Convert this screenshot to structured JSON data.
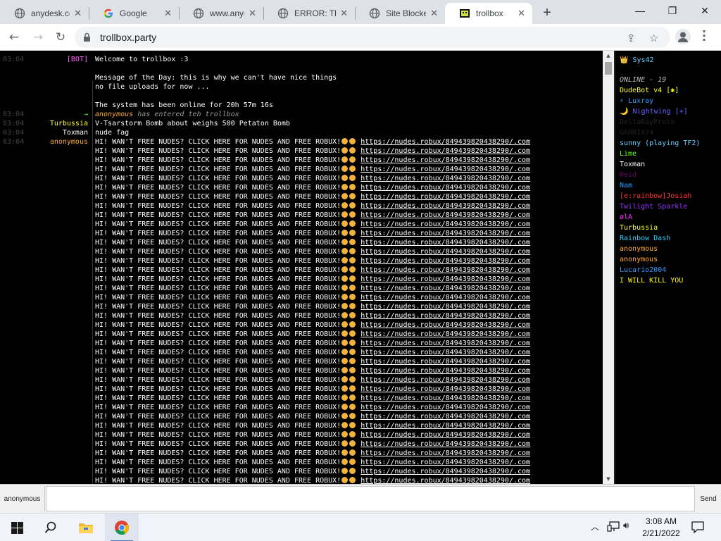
{
  "browser": {
    "tabs": [
      {
        "title": "anydesk.co",
        "icon": "globe-icon"
      },
      {
        "title": "Google",
        "icon": "google-icon"
      },
      {
        "title": "www.anyde",
        "icon": "globe-icon"
      },
      {
        "title": "ERROR: Th",
        "icon": "globe-icon"
      },
      {
        "title": "Site Blocke",
        "icon": "globe-icon"
      },
      {
        "title": "trollbox",
        "icon": "trollbox-icon",
        "active": true
      }
    ],
    "url": "trollbox.party",
    "window": {
      "minimize": "—",
      "restore": "❐",
      "close": "✕"
    }
  },
  "chat": {
    "intro": [
      {
        "ts": "03:04",
        "nick": "[BOT]",
        "nick_color": "#ff66ff",
        "msg": "Welcome to trollbox :3"
      },
      {
        "ts": "",
        "nick": "",
        "nick_color": "#fff",
        "msg": "Message of the Day: this is why we can't have nice things"
      },
      {
        "ts": "",
        "nick": "",
        "nick_color": "#fff",
        "msg": "no file uploads for now ..."
      },
      {
        "ts": "",
        "nick": "",
        "nick_color": "#fff",
        "msg": "The system has been online for 20h 57m 16s"
      }
    ],
    "events": [
      {
        "ts": "03:04",
        "nick": "→",
        "nick_color": "#33ff33",
        "msg": "has entered teh trollbox",
        "who": "anonymous",
        "who_color": "#ffaa33"
      },
      {
        "ts": "03:04",
        "nick": "Turbussia",
        "nick_color": "#ffff33",
        "msg": "V-Tsarstorm Bomb about weighs 500 Petaton Bomb"
      },
      {
        "ts": "03:04",
        "nick": "Toxman",
        "nick_color": "#ffffff",
        "msg": "nude fag"
      }
    ],
    "spam": {
      "ts": "03:04",
      "nick": "anonymous",
      "nick_color": "#ffaa33",
      "text": "HI! WAN'T FREE NUDES? CLICK HERE FOR NUDES AND FREE ROBUX!",
      "link": "https://nudes.robux/849439820438290/.com",
      "repeat": 38
    }
  },
  "users": {
    "header": "👑 Sys42",
    "online_label": "ONLINE - 19",
    "list": [
      {
        "name": "DudeBot v4 [✱]",
        "color": "#ffff33"
      },
      {
        "name": "⚡ Luxray",
        "color": "#3399ff"
      },
      {
        "name": "🌙 Nightwing [+]",
        "color": "#6666ff"
      },
      {
        "name": "DeltaRayProto",
        "color": "#222222"
      },
      {
        "name": "GARRIX74",
        "color": "#222222"
      },
      {
        "name": "sunny (playing TF2)",
        "color": "#66ccff"
      },
      {
        "name": "Lime",
        "color": "#66ff33"
      },
      {
        "name": "Toxman",
        "color": "#ffffff"
      },
      {
        "name": "Reid",
        "color": "#660066"
      },
      {
        "name": "Nam",
        "color": "#3399ff"
      },
      {
        "name": "[e:rainbow]Josiah",
        "color": "#ff3333"
      },
      {
        "name": "Twilight Sparkle",
        "color": "#9933ff"
      },
      {
        "name": "ølA",
        "color": "#ff33ff"
      },
      {
        "name": "Turbussia",
        "color": "#ffff33"
      },
      {
        "name": "Rainbow Dash",
        "color": "#33ccff"
      },
      {
        "name": "anonymous",
        "color": "#ffaa33"
      },
      {
        "name": "anonymous",
        "color": "#ffaa33"
      },
      {
        "name": "Lucario2004",
        "color": "#3399ff"
      },
      {
        "name": "I WILL KILL YOU",
        "color": "#ffff00"
      }
    ]
  },
  "input": {
    "nick": "anonymous",
    "value": "",
    "send_label": "Send"
  },
  "taskbar": {
    "time": "3:08 AM",
    "date": "2/21/2022"
  }
}
